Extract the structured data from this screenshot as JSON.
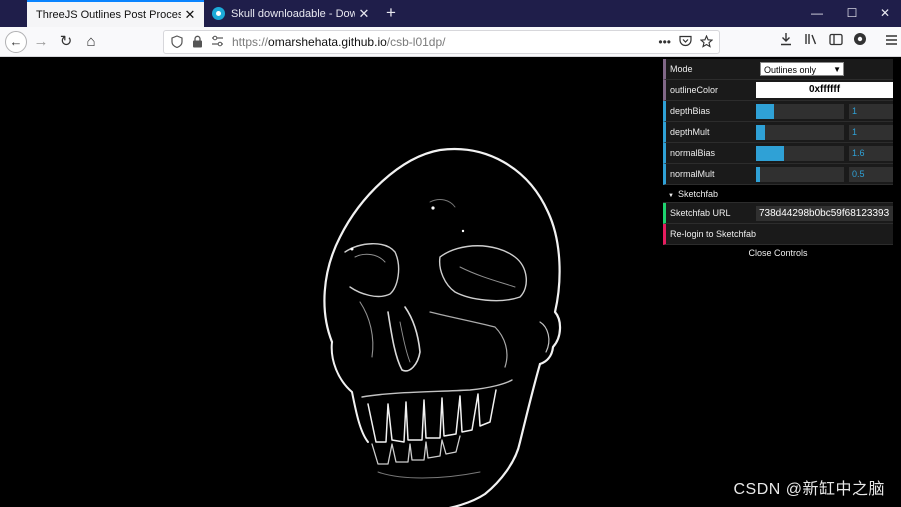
{
  "tabs": [
    {
      "title": "ThreeJS Outlines Post Process",
      "active": true
    },
    {
      "title": "Skull downloadable - Downloa",
      "active": false
    }
  ],
  "tab_close_glyph": "✕",
  "new_tab_glyph": "+",
  "window_controls": {
    "minimize": "—",
    "maximize": "☐",
    "close": "✕"
  },
  "nav": {
    "back": "←",
    "forward": "→",
    "reload": "↻",
    "home": "⌂",
    "url_prefix": "https://",
    "url_host": "omarshehata.github.io",
    "url_path": "/csb-l01dp/",
    "page_actions": "•••"
  },
  "gui": {
    "mode": {
      "label": "Mode",
      "value": "Outlines only"
    },
    "outline_color": {
      "label": "outlineColor",
      "value": "0xffffff"
    },
    "sliders": [
      {
        "label": "depthBias",
        "value": "1",
        "fill": 0.2
      },
      {
        "label": "depthMult",
        "value": "1",
        "fill": 0.1
      },
      {
        "label": "normalBias",
        "value": "1.6",
        "fill": 0.32
      },
      {
        "label": "normalMult",
        "value": "0.5",
        "fill": 0.05
      }
    ],
    "folder": {
      "title": "Sketchfab"
    },
    "sketchfab_url": {
      "label": "Sketchfab URL",
      "value": "738d44298b0bc59f68123393"
    },
    "relogin": {
      "label": "Re-login to Sketchfab"
    },
    "close_controls": "Close Controls"
  },
  "watermark": "CSDN @新缸中之脑",
  "colors": {
    "tab_strip": "#1f1e4a",
    "accent": "#0a84ff",
    "gui_number": "#2fa1d6",
    "gui_string": "#1ed36f",
    "gui_function": "#e61d5f"
  }
}
